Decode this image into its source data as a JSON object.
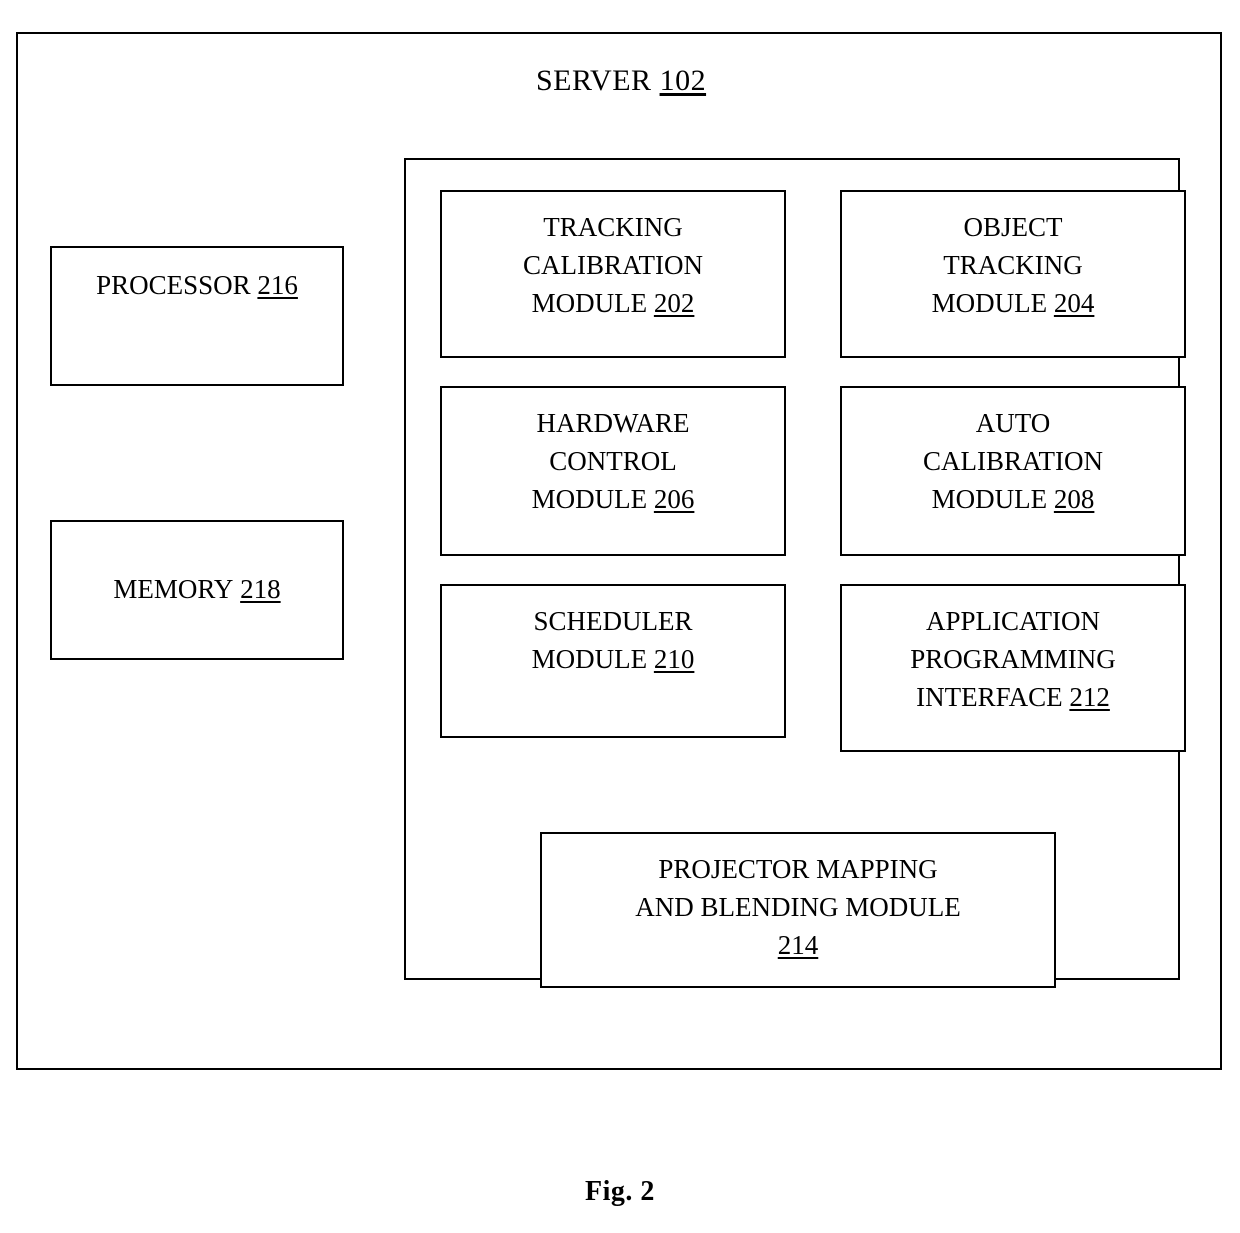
{
  "figure": {
    "caption": "Fig. 2",
    "title_label": "SERVER",
    "title_ref": "102"
  },
  "side_boxes": [
    {
      "id": "processor",
      "lines": [
        "PROCESSOR"
      ],
      "ref": "216"
    },
    {
      "id": "memory",
      "lines": [
        "MEMORY"
      ],
      "ref": "218"
    }
  ],
  "modules": [
    {
      "id": "202",
      "lines": [
        "TRACKING",
        "CALIBRATION",
        "MODULE"
      ],
      "ref": "202"
    },
    {
      "id": "204",
      "lines": [
        "OBJECT",
        "TRACKING",
        "MODULE"
      ],
      "ref": "204"
    },
    {
      "id": "206",
      "lines": [
        "HARDWARE",
        "CONTROL",
        "MODULE"
      ],
      "ref": "206"
    },
    {
      "id": "208",
      "lines": [
        "AUTO",
        "CALIBRATION",
        "MODULE"
      ],
      "ref": "208"
    },
    {
      "id": "210",
      "lines": [
        "SCHEDULER",
        "MODULE"
      ],
      "ref": "210"
    },
    {
      "id": "212",
      "lines": [
        "APPLICATION",
        "PROGRAMMING",
        "INTERFACE"
      ],
      "ref": "212"
    },
    {
      "id": "214",
      "lines": [
        "PROJECTOR MAPPING",
        "AND BLENDING MODULE"
      ],
      "ref": "214"
    }
  ],
  "text": {
    "processor_line1": "PROCESSOR",
    "processor_ref": "216",
    "memory_line1": "MEMORY",
    "memory_ref": "218",
    "m202_l1": "TRACKING",
    "m202_l2": "CALIBRATION",
    "m202_l3": "MODULE",
    "m202_ref": "202",
    "m204_l1": "OBJECT",
    "m204_l2": "TRACKING",
    "m204_l3": "MODULE",
    "m204_ref": "204",
    "m206_l1": "HARDWARE",
    "m206_l2": "CONTROL",
    "m206_l3": "MODULE",
    "m206_ref": "206",
    "m208_l1": "AUTO",
    "m208_l2": "CALIBRATION",
    "m208_l3": "MODULE",
    "m208_ref": "208",
    "m210_l1": "SCHEDULER",
    "m210_l2": "MODULE",
    "m210_ref": "210",
    "m212_l1": "APPLICATION",
    "m212_l2": "PROGRAMMING",
    "m212_l3": "INTERFACE",
    "m212_ref": "212",
    "m214_l1": "PROJECTOR MAPPING",
    "m214_l2": "AND BLENDING MODULE",
    "m214_ref": "214"
  },
  "colors": {
    "stroke": "#000000",
    "background": "#ffffff",
    "text": "#000000"
  }
}
